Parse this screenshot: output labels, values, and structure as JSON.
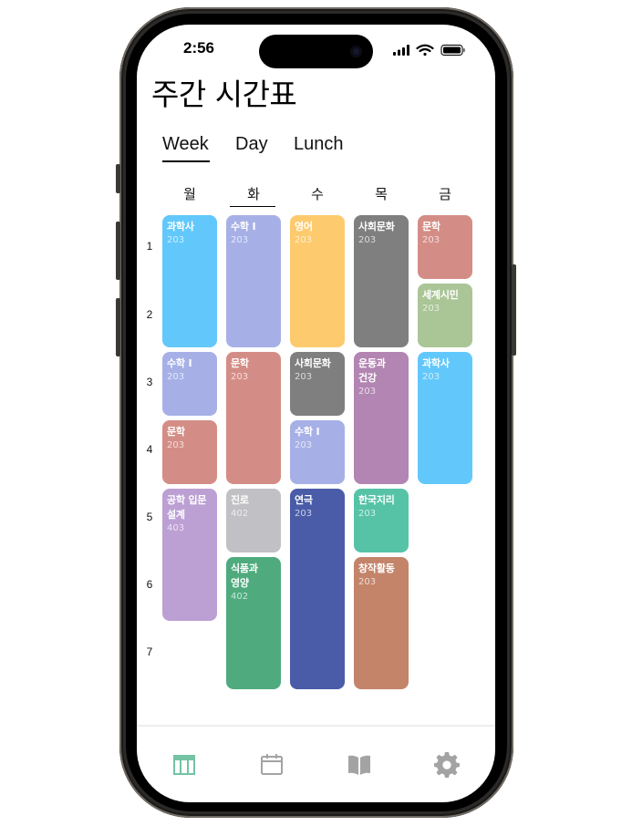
{
  "status_bar": {
    "time": "2:56"
  },
  "header": {
    "title": "주간 시간표"
  },
  "tabs": [
    {
      "label": "Week",
      "selected": true
    },
    {
      "label": "Day",
      "selected": false
    },
    {
      "label": "Lunch",
      "selected": false
    }
  ],
  "days": [
    {
      "label": "월",
      "selected": false
    },
    {
      "label": "화",
      "selected": true
    },
    {
      "label": "수",
      "selected": false
    },
    {
      "label": "목",
      "selected": false
    },
    {
      "label": "금",
      "selected": false
    }
  ],
  "periods": [
    "1",
    "2",
    "3",
    "4",
    "5",
    "6",
    "7"
  ],
  "schedule": {
    "mon": [
      {
        "subject": "과학사",
        "room": "203",
        "start": 1,
        "span": 2,
        "color": "#62c8fb"
      },
      {
        "subject": "수학 I",
        "room": "203",
        "start": 3,
        "span": 1,
        "color": "#a7b0e6"
      },
      {
        "subject": "문학",
        "room": "203",
        "start": 4,
        "span": 1,
        "color": "#d48d86"
      },
      {
        "subject": "공학 입문 설계",
        "room": "403",
        "start": 5,
        "span": 2,
        "color": "#bca0d4"
      }
    ],
    "tue": [
      {
        "subject": "수학 I",
        "room": "203",
        "start": 1,
        "span": 2,
        "color": "#a7b0e6"
      },
      {
        "subject": "문학",
        "room": "203",
        "start": 3,
        "span": 2,
        "color": "#d48d86"
      },
      {
        "subject": "진로",
        "room": "402",
        "start": 5,
        "span": 1,
        "color": "#c1c1c5"
      },
      {
        "subject": "식품과 영양",
        "room": "402",
        "start": 6,
        "span": 2,
        "color": "#4fab7e"
      }
    ],
    "wed": [
      {
        "subject": "영어",
        "room": "203",
        "start": 1,
        "span": 2,
        "color": "#fdcb6e"
      },
      {
        "subject": "사회문화",
        "room": "203",
        "start": 3,
        "span": 1,
        "color": "#7f7f80"
      },
      {
        "subject": "수학 I",
        "room": "203",
        "start": 4,
        "span": 1,
        "color": "#a7b0e6"
      },
      {
        "subject": "연극",
        "room": "203",
        "start": 5,
        "span": 3,
        "color": "#4a5ca8"
      }
    ],
    "thu": [
      {
        "subject": "사회문화",
        "room": "203",
        "start": 1,
        "span": 2,
        "color": "#7f7f80"
      },
      {
        "subject": "운동과 건강",
        "room": "203",
        "start": 3,
        "span": 2,
        "color": "#b385b2"
      },
      {
        "subject": "한국지리",
        "room": "203",
        "start": 5,
        "span": 1,
        "color": "#56c3a7"
      },
      {
        "subject": "창작활동",
        "room": "203",
        "start": 6,
        "span": 2,
        "color": "#c3846a"
      }
    ],
    "fri": [
      {
        "subject": "문학",
        "room": "203",
        "start": 1,
        "span": 1,
        "color": "#d48d86"
      },
      {
        "subject": "세계시민",
        "room": "203",
        "start": 2,
        "span": 1,
        "color": "#aac596"
      },
      {
        "subject": "과학사",
        "room": "203",
        "start": 3,
        "span": 2,
        "color": "#62c8fb"
      }
    ]
  },
  "bottom_tabs": [
    {
      "icon": "timetable-icon",
      "selected": true,
      "color": "#74c3a3"
    },
    {
      "icon": "calendar-icon",
      "selected": false,
      "color": "#a3a3a3"
    },
    {
      "icon": "book-icon",
      "selected": false,
      "color": "#a3a3a3"
    },
    {
      "icon": "gear-icon",
      "selected": false,
      "color": "#a3a3a3"
    }
  ]
}
